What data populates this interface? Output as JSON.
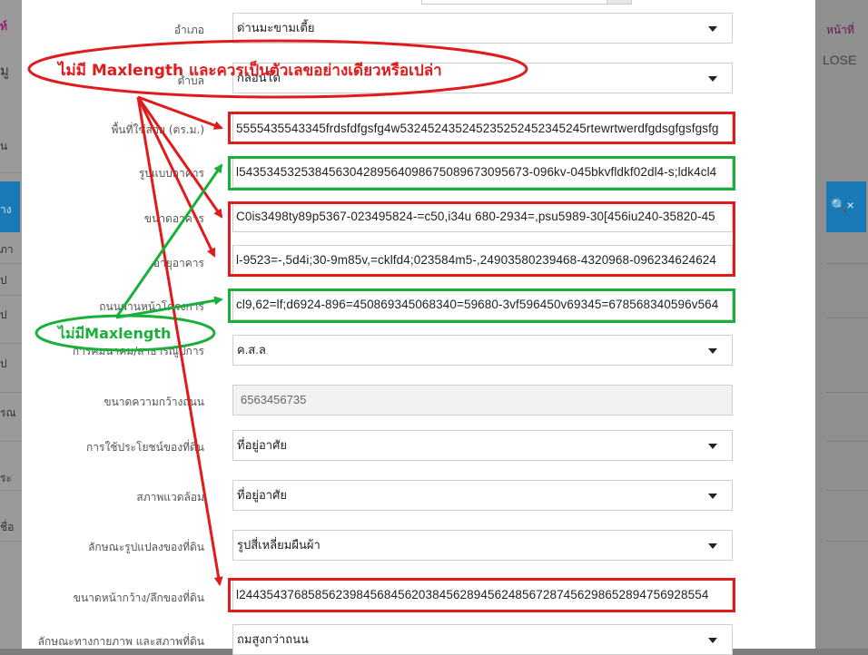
{
  "background": {
    "left_fragments": [
      "ท์",
      "มู",
      "น",
      "าง",
      "ภา",
      "ูป",
      "ป",
      "ป",
      "รณ",
      "ระ",
      "ชื่อ"
    ],
    "right_nav": "หน้าที่ ",
    "right_close": "LOSE",
    "right_search_icon": "🔍",
    "right_close_glyph": "×"
  },
  "form": {
    "rows": [
      {
        "label": "อำเภอ",
        "type": "select",
        "value": "ด่านมะขามเตี้ย"
      },
      {
        "label": "ตำบล",
        "type": "select",
        "value": "กลอนโด"
      },
      {
        "label": "พื้นที่ใช้สอย (ตร.ม.)",
        "type": "text",
        "value": "5555435543345frdsfdfgsfg4w53245243524523525245234524​5rtewrtwerdfgdsgfgsfgsfg"
      },
      {
        "label": "รูปแบบอาคาร",
        "type": "text",
        "value": "l5435345325384563042895640986750896730956​73-096kv-045bkvfldkf02dl4-s;ldk4cl4"
      },
      {
        "label": "ขนาดอาคาร",
        "type": "text",
        "value": "C0is3498ty89p5367-023495824-=c50,i34u 680-2934=,psu5989-30[456iu240-35820-45"
      },
      {
        "label": "อายุอาคาร",
        "type": "text",
        "value": "l-9523=-,5d4i;30-9m85v,=cklfd4;023584m5-,24903580239468-4320968-096234624624"
      },
      {
        "label": "ถนนผ่านหน้าโครงการ",
        "type": "text",
        "value": "cl9,62=lf;d6924-896=450869345068340=59680-3vf596450v69345=678568340596v564"
      },
      {
        "label": "การคมนาคม/สาธารณูปการ",
        "type": "select",
        "value": "ค.ส.ล"
      },
      {
        "label": "ขนาดความกว้างถนน",
        "type": "readonly",
        "value": "6563456735"
      },
      {
        "label": "การใช้ประโยชน์ของที่ดิน",
        "type": "select",
        "value": "ที่อยู่อาศัย"
      },
      {
        "label": "สภาพแวดล้อม",
        "type": "select",
        "value": "ที่อยู่อาศัย"
      },
      {
        "label": "ลักษณะรูปแปลงของที่ดิน",
        "type": "select",
        "value": "รูปสี่เหลี่ยมผืนผ้า"
      },
      {
        "label": "ขนาดหน้ากว้าง/ลึกของที่ดิน",
        "type": "text",
        "value": "l24435437685856239845684562038456289456248567287456298652894756928554"
      },
      {
        "label": "ลักษณะทางกายภาพ และสภาพที่ดิน",
        "type": "select",
        "value": "ถมสูงกว่าถนน"
      }
    ]
  },
  "annotations": {
    "red_callout": "ไม่มี Maxlength และควรเป็นตัวเลขอย่างเดียวหรือเปล่า",
    "green_callout": "ไม่มีMaxlength",
    "colors": {
      "red": "#e01b1b",
      "green": "#19b03a"
    }
  }
}
